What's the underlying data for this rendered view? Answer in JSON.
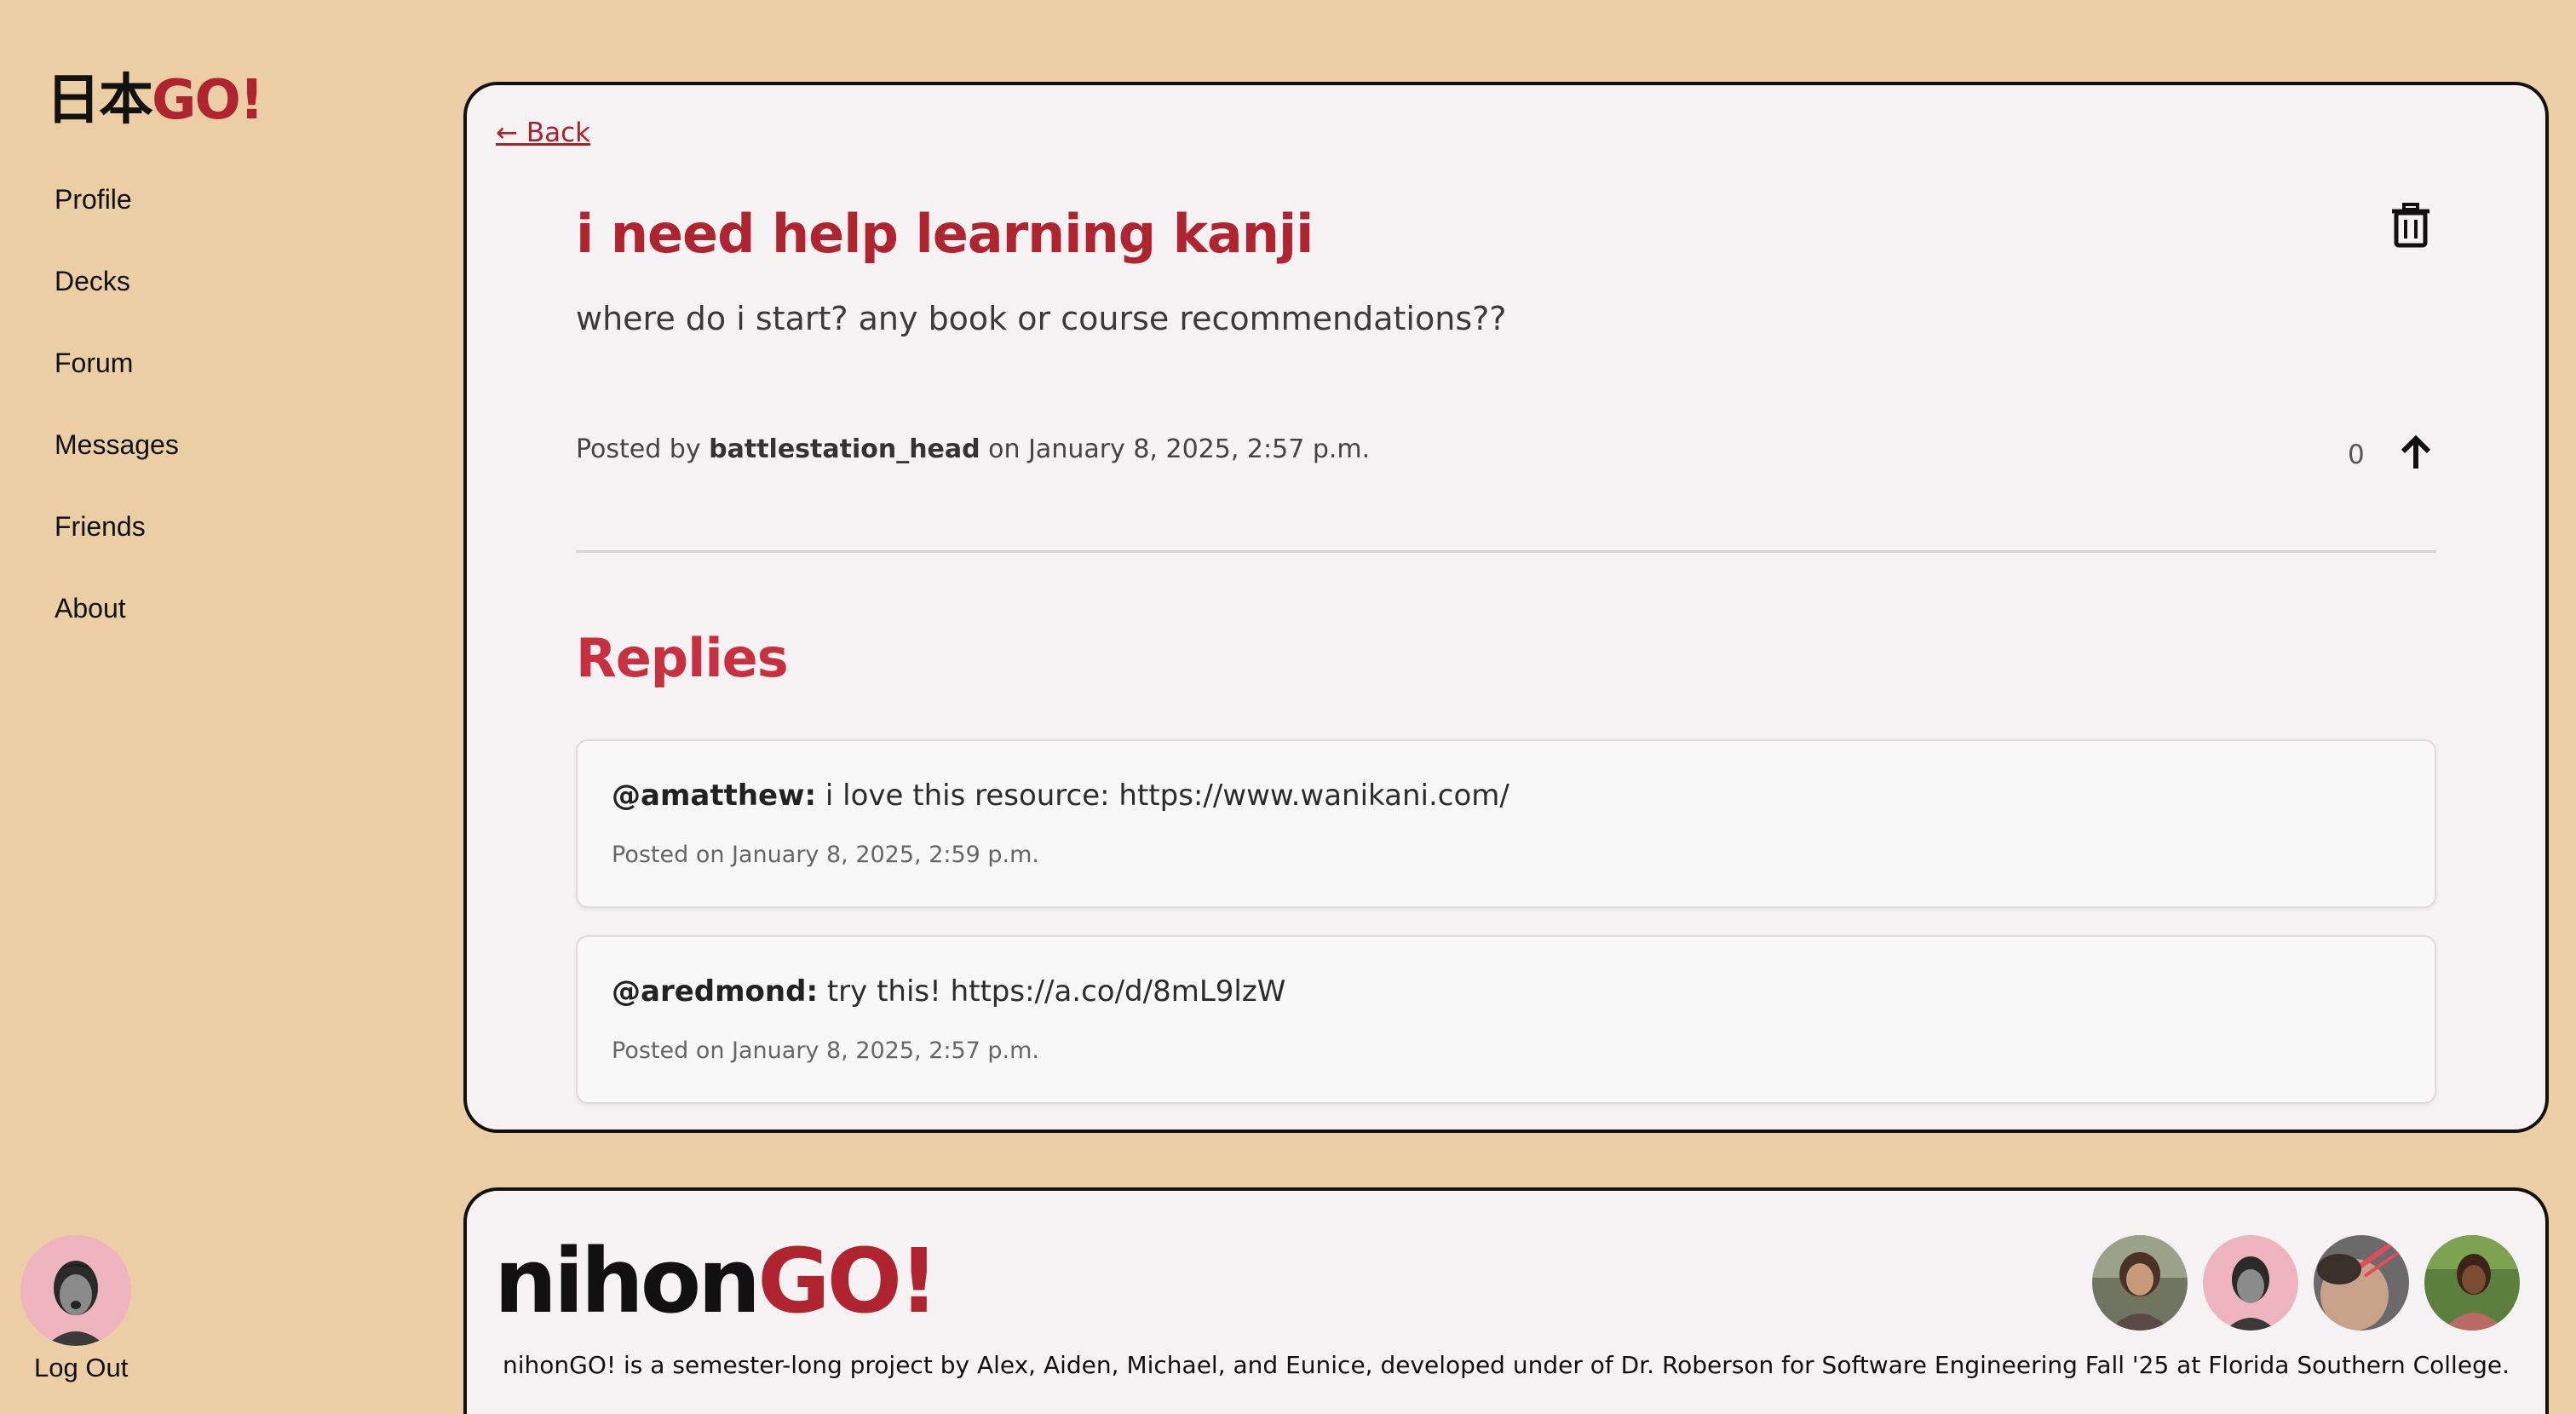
{
  "sidebar": {
    "logo_jp": "日本",
    "logo_go": "GO!",
    "items": [
      {
        "label": "Profile"
      },
      {
        "label": "Decks"
      },
      {
        "label": "Forum"
      },
      {
        "label": "Messages"
      },
      {
        "label": "Friends"
      },
      {
        "label": "About"
      }
    ],
    "logout_label": "Log Out"
  },
  "post": {
    "back_label": "← Back",
    "title": "i need help learning kanji",
    "body": "where do i start? any book or course recommendations??",
    "meta_prefix": "Posted by ",
    "author": "battlestation_head",
    "meta_suffix": " on January 8, 2025, 2:57 p.m.",
    "votes": "0",
    "trash_icon": "trash-icon",
    "upvote_icon": "arrow-up-icon"
  },
  "replies": {
    "heading": "Replies",
    "items": [
      {
        "user": "@amatthew:",
        "text": " i love this resource: https://www.wanikani.com/",
        "time": "Posted on January 8, 2025, 2:59 p.m."
      },
      {
        "user": "@aredmond:",
        "text": " try this! https://a.co/d/8mL9lzW",
        "time": "Posted on January 8, 2025, 2:57 p.m."
      }
    ]
  },
  "footer": {
    "logo_a": "nihon",
    "logo_b": "GO!",
    "description": "nihonGO! is a semester-long project by Alex, Aiden, Michael, and Eunice, developed under of Dr. Roberson for Software Engineering Fall '25 at Florida Southern College."
  },
  "colors": {
    "background": "#ebcea3",
    "accent": "#b0242f",
    "card": "#f5f2f4"
  }
}
